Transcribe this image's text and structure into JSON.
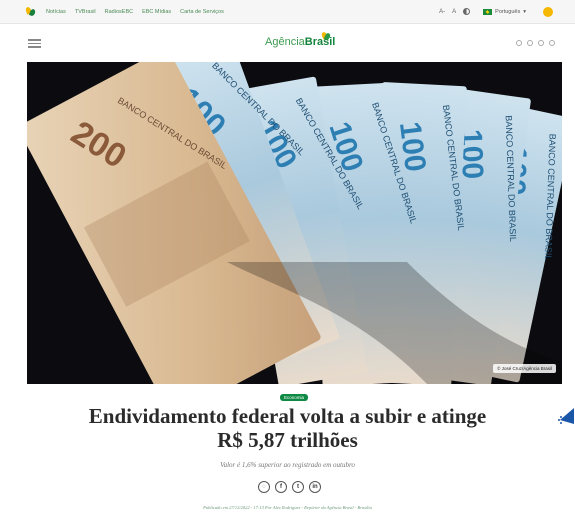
{
  "topbar": {
    "links": [
      "Notícias",
      "TVBrasil",
      "RadiosEBC",
      "EBC Mídias",
      "Carta de Serviços"
    ],
    "font_small": "A-",
    "font_large": "A",
    "language": "Português"
  },
  "header": {
    "brand_light": "Agência",
    "brand_bold": "Brasil"
  },
  "hero": {
    "credit": "© José Cruz/Agência Brasil",
    "bill_printed_texts": [
      "200",
      "100",
      "100",
      "100",
      "100",
      "100",
      "BANCO CENTRAL DO BRASIL"
    ]
  },
  "article": {
    "category": "Economia",
    "headline_line1": "Endividamento federal volta a subir e atinge",
    "headline_line2": "R$ 5,87 trilhões",
    "subheadline": "Valor é 1,6% superior ao registrado em outubro",
    "byline": "Publicado em 27/12/2022 - 17:13 Por Alex Rodrigues - Repórter da Agência Brasil - Brasília"
  },
  "share_icons": [
    "whatsapp-icon",
    "facebook-icon",
    "twitter-icon",
    "linkedin-icon"
  ],
  "colors": {
    "brand_green": "#14843d",
    "brand_yellow": "#f2b800",
    "category_badge": "#0f8a45"
  }
}
